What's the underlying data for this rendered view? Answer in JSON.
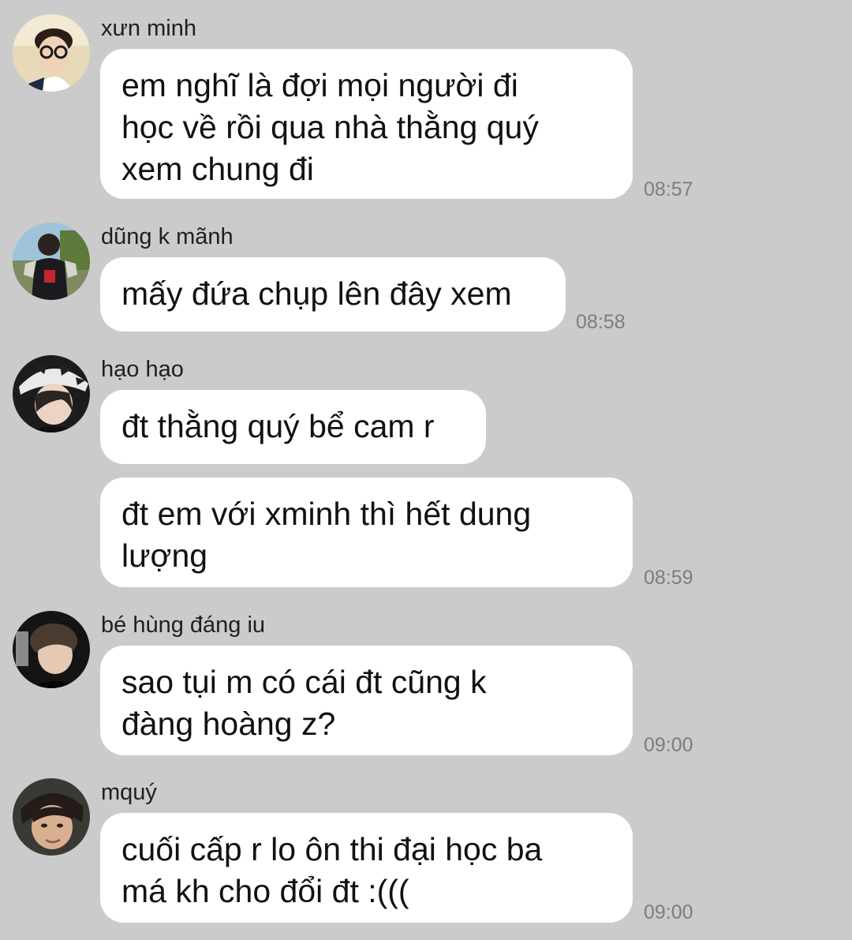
{
  "messages": [
    {
      "sender": "xưn minh",
      "text": "em nghĩ là đợi mọi người đi\nhọc về rồi qua nhà thằng quý\nxem chung đi",
      "time": "08:57"
    },
    {
      "sender": "dũng k mãnh",
      "text": "mấy đứa chụp lên đây xem",
      "time": "08:58"
    },
    {
      "sender": "hạo hạo",
      "text": "đt thằng quý bể cam r"
    },
    {
      "text": "đt em với xminh thì hết dung\nlượng",
      "time": "08:59"
    },
    {
      "sender": "bé hùng đáng iu",
      "text": "sao tụi m có cái đt cũng k\nđàng hoàng z?",
      "time": "09:00"
    },
    {
      "sender": "mquý",
      "text": "cuối cấp r lo ôn thi đại học ba\nmá kh cho đổi đt :(((",
      "time": "09:00"
    }
  ],
  "colors": {
    "background": "#cbcbcb",
    "bubble": "#ffffff",
    "text": "#111111",
    "timestamp": "#7d7d7d"
  },
  "icons": [
    "avatar-xun-minh",
    "avatar-dung-k-manh",
    "avatar-hao-hao",
    "avatar-be-hung-dang-iu",
    "avatar-mquy"
  ]
}
